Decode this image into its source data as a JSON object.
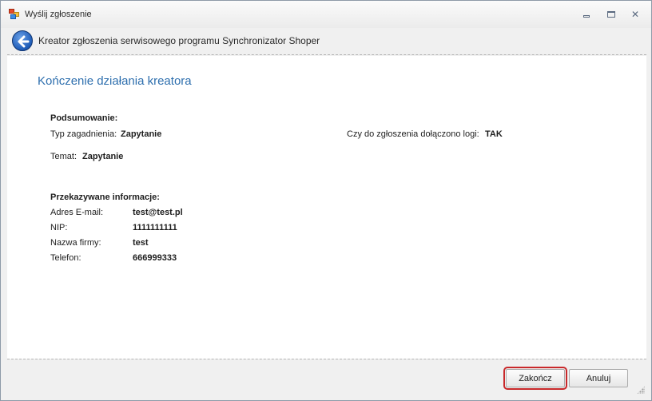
{
  "window": {
    "title": "Wyślij zgłoszenie"
  },
  "header": {
    "title": "Kreator zgłoszenia serwisowego programu Synchronizator Shoper"
  },
  "page": {
    "title": "Kończenie działania kreatora"
  },
  "summary": {
    "heading": "Podsumowanie:",
    "type_label": "Typ zagadnienia:",
    "type_value": "Zapytanie",
    "logs_label": "Czy do zgłoszenia dołączono logi:",
    "logs_value": "TAK",
    "subject_label": "Temat:",
    "subject_value": "Zapytanie"
  },
  "info": {
    "heading": "Przekazywane informacje:",
    "rows": [
      {
        "label": "Adres E-mail:",
        "value": "test@test.pl"
      },
      {
        "label": "NIP:",
        "value": "1111111111"
      },
      {
        "label": "Nazwa firmy:",
        "value": "test"
      },
      {
        "label": "Telefon:",
        "value": "666999333"
      }
    ]
  },
  "footer": {
    "finish_label": "Zakończ",
    "cancel_label": "Anuluj"
  },
  "icons": {
    "back": "back-arrow-icon",
    "app": "app-icon",
    "minimize": "minimize-icon",
    "maximize": "maximize-icon",
    "close": "close-icon"
  },
  "colors": {
    "accent": "#2e6fae",
    "highlight": "#c8282a"
  }
}
